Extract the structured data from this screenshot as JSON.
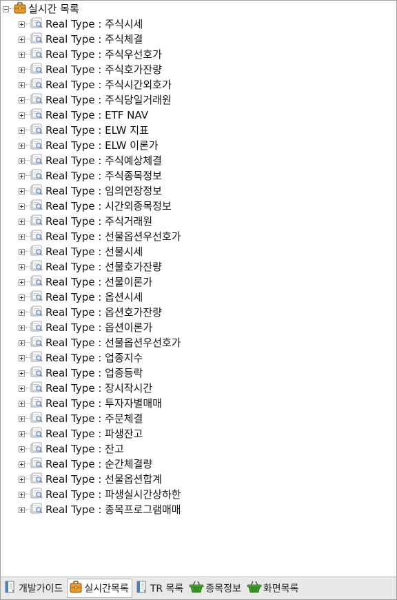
{
  "tree": {
    "root_label": "실시간 목록",
    "items": [
      "Real Type : 주식시세",
      "Real Type : 주식체결",
      "Real Type : 주식우선호가",
      "Real Type : 주식호가잔량",
      "Real Type : 주식시간외호가",
      "Real Type : 주식당일거래원",
      "Real Type : ETF NAV",
      "Real Type : ELW 지표",
      "Real Type : ELW 이론가",
      "Real Type : 주식예상체결",
      "Real Type : 주식종목정보",
      "Real Type : 임의연장정보",
      "Real Type : 시간외종목정보",
      "Real Type : 주식거래원",
      "Real Type : 선물옵션우선호가",
      "Real Type : 선물시세",
      "Real Type : 선물호가잔량",
      "Real Type : 선물이론가",
      "Real Type : 옵션시세",
      "Real Type : 옵션호가잔량",
      "Real Type : 옵션이론가",
      "Real Type : 선물옵션우선호가",
      "Real Type : 업종지수",
      "Real Type : 업종등락",
      "Real Type : 장시작시간",
      "Real Type : 투자자별매매",
      "Real Type : 주문체결",
      "Real Type : 파생잔고",
      "Real Type : 잔고",
      "Real Type : 순간체결량",
      "Real Type : 선물옵션합계",
      "Real Type : 파생실시간상하한",
      "Real Type : 종목프로그램매매"
    ]
  },
  "tabs": [
    {
      "label": "개발가이드",
      "icon": "document-icon",
      "active": false
    },
    {
      "label": "실시간목록",
      "icon": "briefcase-icon",
      "active": true
    },
    {
      "label": "TR 목록",
      "icon": "document-icon",
      "active": false
    },
    {
      "label": "종목정보",
      "icon": "basket-icon",
      "active": false
    },
    {
      "label": "화면목록",
      "icon": "basket-icon",
      "active": false
    }
  ],
  "colors": {
    "briefcase": "#d9882a",
    "basket": "#3a9a2a",
    "document": "#4a7fb8"
  }
}
